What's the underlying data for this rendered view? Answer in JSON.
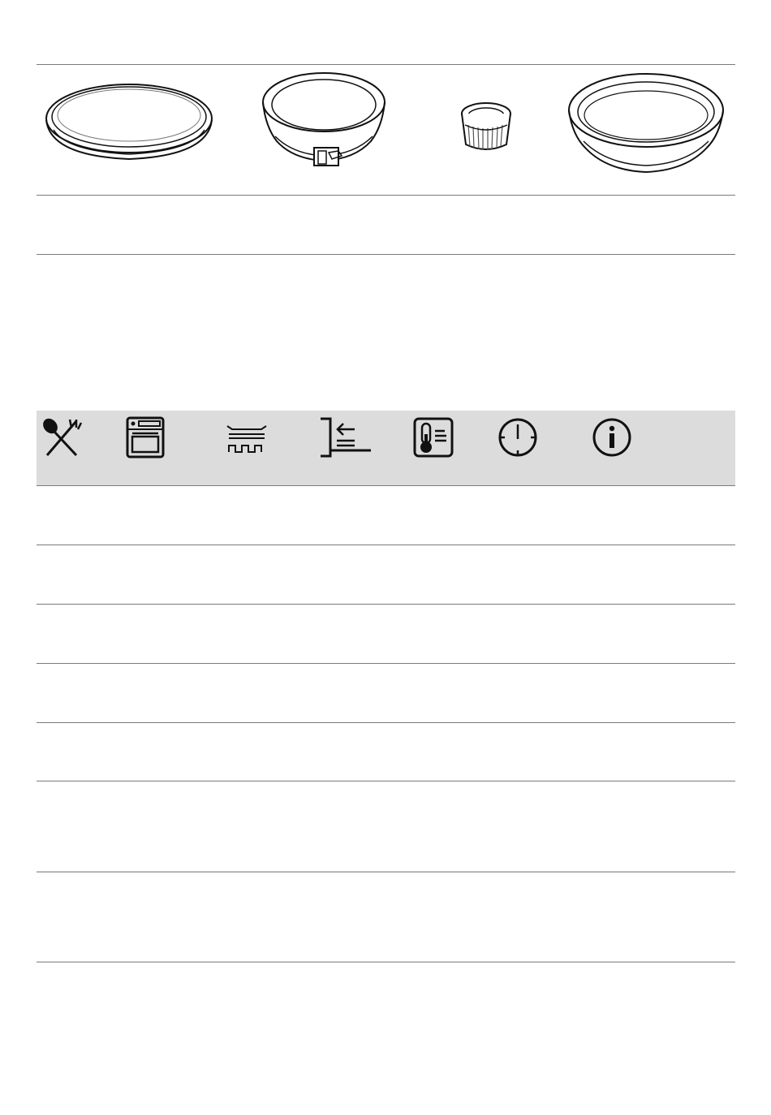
{
  "bakeware_row": {
    "items": [
      {
        "icon": "flat-tart-pan-icon"
      },
      {
        "icon": "springform-pan-icon"
      },
      {
        "icon": "ramekin-icon"
      },
      {
        "icon": "round-cake-pan-icon"
      }
    ],
    "description_row": ""
  },
  "settings_table": {
    "header_icons": [
      "food-spoon-fork-icon",
      "oven-icon",
      "accessory-shelf-icon",
      "shelf-position-icon",
      "temperature-icon",
      "timer-icon",
      "info-icon"
    ],
    "rows": [
      {
        "cells": []
      },
      {
        "cells": []
      },
      {
        "cells": []
      },
      {
        "cells": []
      },
      {
        "cells": []
      },
      {
        "cells": []
      },
      {
        "cells": []
      }
    ]
  }
}
